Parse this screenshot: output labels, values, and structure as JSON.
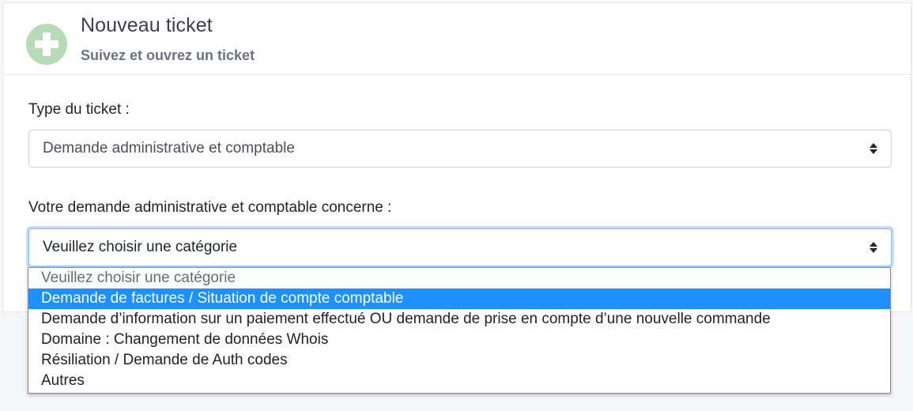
{
  "header": {
    "title": "Nouveau ticket",
    "subtitle": "Suivez et ouvrez un ticket",
    "icon": "plus-circle-icon"
  },
  "form": {
    "type_label": "Type du ticket :",
    "type_value": "Demande administrative et comptable",
    "category_label": "Votre demande administrative et comptable concerne :",
    "category_value": "Veuillez choisir une catégorie"
  },
  "dropdown": {
    "options": [
      "Veuillez choisir une catégorie",
      "Demande de factures / Situation de compte comptable",
      "Demande d’information sur un paiement effectué OU demande de prise en compte d’une nouvelle commande",
      "Domaine : Changement de données Whois",
      "Résiliation / Demande de Auth codes",
      "Autres"
    ],
    "highlighted": "Demande de factures / Situation de compte comptable"
  },
  "colors": {
    "accent": "#1e90ff",
    "icon_green": "#b7dbb7",
    "focus_border": "#80bdff"
  }
}
